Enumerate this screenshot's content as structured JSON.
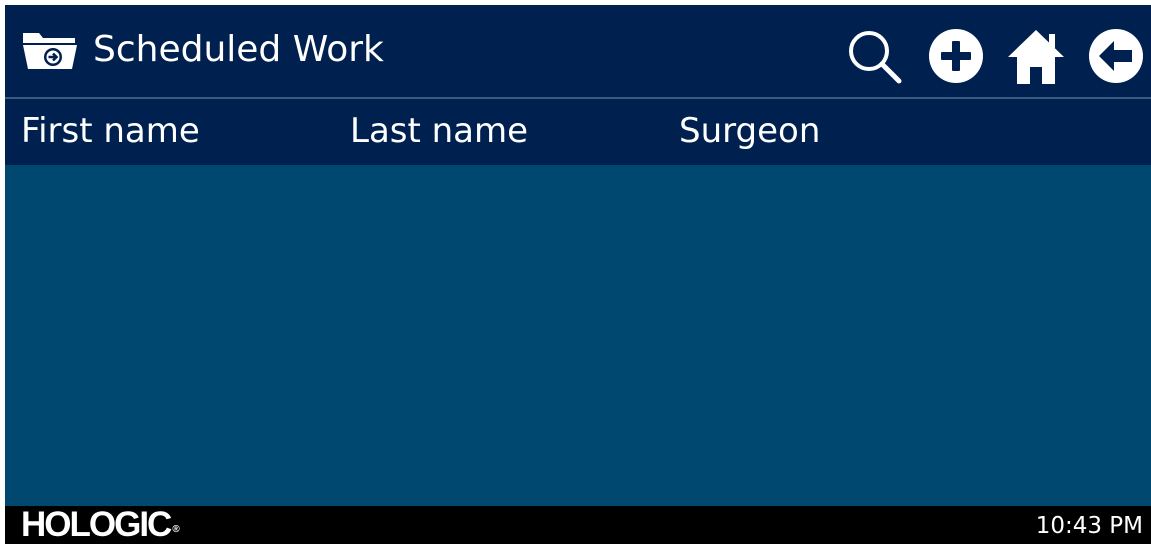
{
  "header": {
    "title": "Scheduled Work",
    "title_icon": "folder-arrow-icon",
    "actions": [
      {
        "name": "search",
        "icon": "magnifier-icon"
      },
      {
        "name": "add",
        "icon": "plus-circle-icon"
      },
      {
        "name": "home",
        "icon": "home-icon"
      },
      {
        "name": "back",
        "icon": "back-arrow-circle-icon"
      }
    ]
  },
  "table": {
    "columns": [
      "First name",
      "Last name",
      "Surgeon"
    ],
    "rows": []
  },
  "footer": {
    "brand": "HOLOGIC",
    "brand_mark": "®",
    "time": "10:43 PM"
  },
  "colors": {
    "header_bg": "#00214f",
    "list_bg": "#004870",
    "footer_bg": "#000000",
    "text": "#ffffff"
  }
}
